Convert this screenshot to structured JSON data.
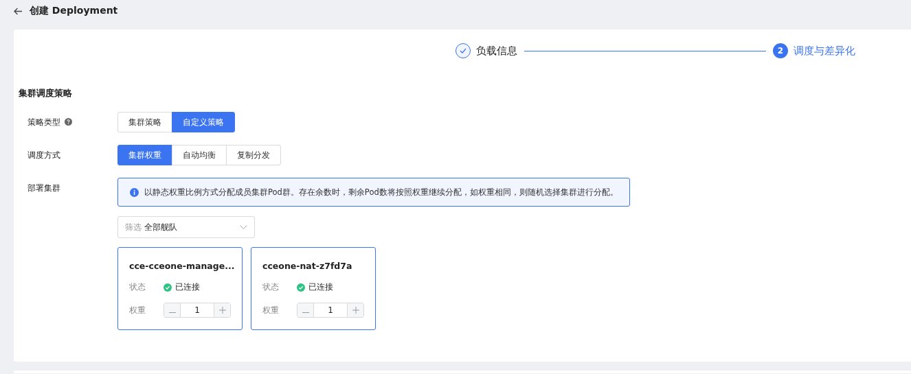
{
  "header": {
    "title": "创建 Deployment"
  },
  "steps": [
    {
      "label": "负载信息",
      "completed": true,
      "active": false
    },
    {
      "label": "调度与差异化",
      "number": "2",
      "completed": false,
      "active": true
    }
  ],
  "section_title": "集群调度策略",
  "fields": [
    {
      "label": "策略类型",
      "help": true,
      "options": [
        {
          "label": "集群策略",
          "selected": false
        },
        {
          "label": "自定义策略",
          "selected": true
        }
      ]
    },
    {
      "label": "调度方式",
      "options": [
        {
          "label": "集群权重",
          "selected": true
        },
        {
          "label": "自动均衡",
          "selected": false
        },
        {
          "label": "复制分发",
          "selected": false
        }
      ]
    }
  ],
  "deploy_cluster": {
    "label": "部署集群",
    "notice": "以静态权重比例方式分配成员集群Pod群。存在余数时，剩余Pod数将按照权重继续分配，如权重相同，则随机选择集群进行分配。",
    "filter": {
      "prefix": "筛选",
      "value": "全部舰队"
    },
    "clusters": [
      {
        "name": "cce-cceone-manage...",
        "status_label": "状态",
        "status": "已连接",
        "connected": true,
        "selected": true,
        "weight_label": "权重",
        "weight": "1"
      },
      {
        "name": "cceone-nat-z7fd7a",
        "status_label": "状态",
        "status": "已连接",
        "connected": true,
        "selected": true,
        "weight_label": "权重",
        "weight": "1"
      }
    ]
  }
}
